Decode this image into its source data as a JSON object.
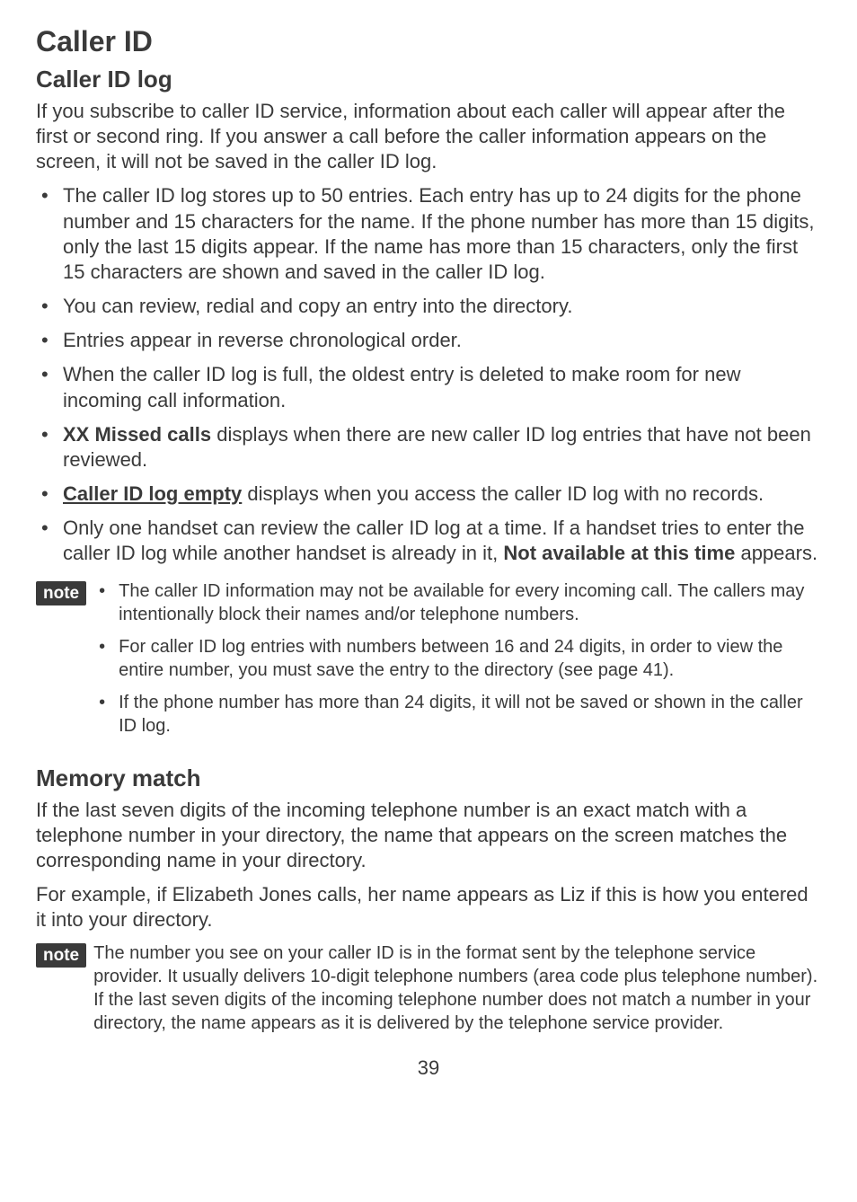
{
  "title": "Caller ID",
  "section1": {
    "heading": "Caller ID log",
    "intro": "If you subscribe to caller ID service, information about each caller will appear after the first or second ring. If you answer a call before the caller information appears on the screen, it will not be saved in the caller ID log.",
    "bullets": {
      "b1": "The caller ID log stores up to 50 entries. Each entry has up to 24 digits for the phone number and 15 characters for the name. If the phone number has more than 15 digits, only the last 15 digits appear. If the name has more than 15 characters, only the first 15 characters are shown and saved in the caller ID log.",
      "b2": "You can review, redial and copy an entry into the directory.",
      "b3": "Entries appear in reverse chronological order.",
      "b4": "When the caller ID log is full, the oldest entry is deleted to make room for new incoming call information.",
      "b5_bold": "XX Missed calls",
      "b5_rest": " displays when there are new caller ID log entries that have not been reviewed.",
      "b6_bold": "Caller ID log empty",
      "b6_rest": " displays when you access the caller ID log with no records.",
      "b7_a": "Only one handset can review the caller ID log at a time. If a handset tries to enter the caller ID log while another handset is already in it, ",
      "b7_bold": "Not available at this time",
      "b7_b": " appears."
    },
    "note_label": "note",
    "note_bullets": {
      "n1": "The caller ID information may not be available for every incoming call. The callers may intentionally block their names and/or telephone numbers.",
      "n2": "For caller ID log entries with numbers between 16 and 24 digits, in order to view the entire number, you must save the entry to the directory (see page 41).",
      "n3": "If the phone number has more than 24 digits, it will not be saved or shown in the caller ID log."
    }
  },
  "section2": {
    "heading": "Memory match",
    "p1": "If the last seven digits of the incoming telephone number is an exact match with a telephone number in your directory, the name that appears on the screen matches the corresponding name in your directory.",
    "p2": "For example, if Elizabeth Jones calls, her name appears as Liz if this is how you entered it into your directory.",
    "note_label": "note",
    "note_para": "The number you see on your caller ID is in the format sent by the telephone service provider. It usually delivers 10-digit telephone numbers (area code plus telephone number). If the last seven digits of the incoming telephone number does not match a number in your directory, the name appears as it is delivered by the telephone service provider."
  },
  "page_number": "39"
}
